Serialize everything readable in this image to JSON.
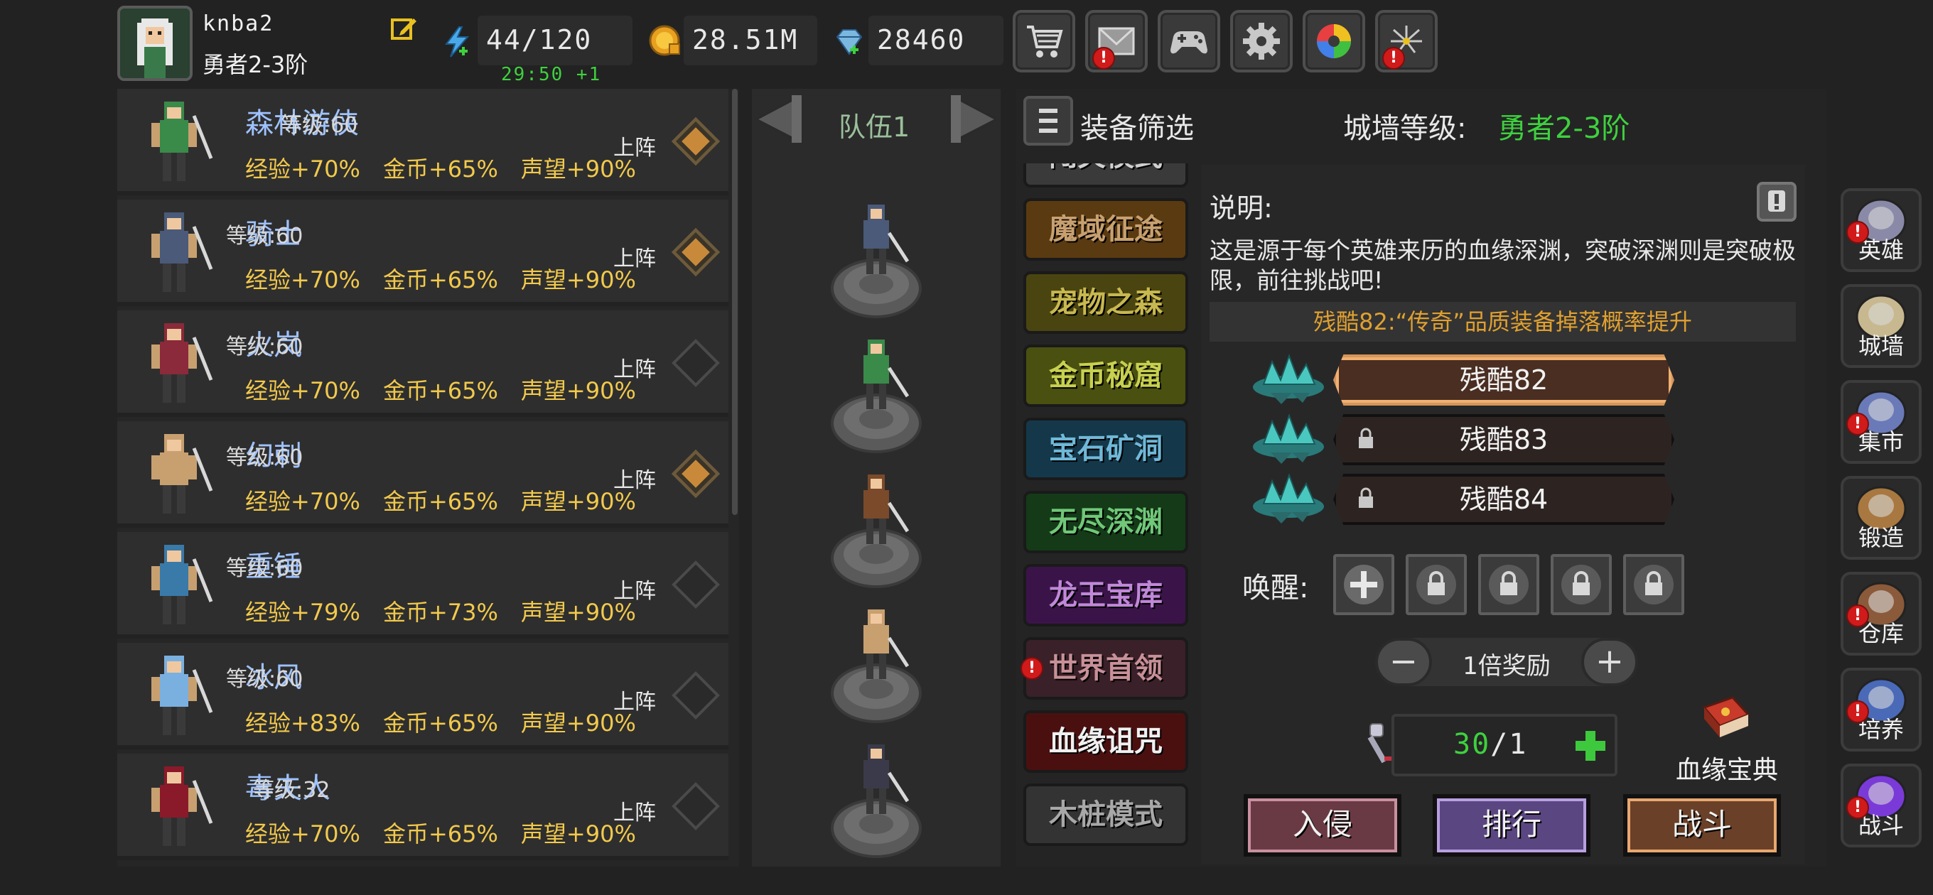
{
  "player": {
    "name": "knba2",
    "rank": "勇者2-3阶"
  },
  "resources": {
    "energy": "44/120",
    "energy_timer": "29:50 +1",
    "gold": "28.51M",
    "gems": "28460"
  },
  "top_buttons": [
    {
      "name": "shop",
      "icon": "cart-icon",
      "alert": false
    },
    {
      "name": "mail",
      "icon": "mail-icon",
      "alert": true
    },
    {
      "name": "gamepad",
      "icon": "gamepad-icon",
      "alert": false
    },
    {
      "name": "settings",
      "icon": "gear-icon",
      "alert": false
    },
    {
      "name": "gacha",
      "icon": "color-wheel-icon",
      "alert": false
    },
    {
      "name": "fireworks",
      "icon": "fireworks-icon",
      "alert": true
    }
  ],
  "heroes": [
    {
      "name": "森林游侠",
      "level": "等级:60",
      "exp": "经验+70%",
      "gold": "金币+65%",
      "fame": "声望+90%",
      "deploy": "上阵",
      "active": true,
      "color": "#3a8a4a"
    },
    {
      "name": "骑士",
      "level": "等级:60",
      "exp": "经验+70%",
      "gold": "金币+65%",
      "fame": "声望+90%",
      "deploy": "上阵",
      "active": true,
      "color": "#4a5a78"
    },
    {
      "name": "火岚",
      "level": "等级:60",
      "exp": "经验+70%",
      "gold": "金币+65%",
      "fame": "声望+90%",
      "deploy": "上阵",
      "active": false,
      "color": "#8a2a3a"
    },
    {
      "name": "幻刺",
      "level": "等级:60",
      "exp": "经验+70%",
      "gold": "金币+65%",
      "fame": "声望+90%",
      "deploy": "上阵",
      "active": true,
      "color": "#c8a070"
    },
    {
      "name": "重锤",
      "level": "等级:60",
      "exp": "经验+79%",
      "gold": "金币+73%",
      "fame": "声望+90%",
      "deploy": "上阵",
      "active": false,
      "color": "#3a7aa8"
    },
    {
      "name": "冰风",
      "level": "等级:60",
      "exp": "经验+83%",
      "gold": "金币+65%",
      "fame": "声望+90%",
      "deploy": "上阵",
      "active": false,
      "color": "#7ab0e0"
    },
    {
      "name": "毒夫人",
      "level": "等级:32",
      "exp": "经验+70%",
      "gold": "金币+65%",
      "fame": "声望+90%",
      "deploy": "上阵",
      "active": false,
      "color": "#8a1a2a"
    }
  ],
  "team": {
    "title": "队伍1",
    "members": [
      "#4a5a78",
      "#3a8a4a",
      "#7a4a2a",
      "#c8a070",
      "#3a3a4a"
    ]
  },
  "filter_label": "装备筛选",
  "wall": {
    "label": "城墙等级:",
    "value": "勇者2-3阶"
  },
  "modes": [
    {
      "label": "闯关模式",
      "bg": "#3a3a3a",
      "fg": "#d0d0d0"
    },
    {
      "label": "魔域征途",
      "bg": "#5a3a10",
      "fg": "#c8a070"
    },
    {
      "label": "宠物之森",
      "bg": "#4a4410",
      "fg": "#c8b850"
    },
    {
      "label": "金币秘窟",
      "bg": "#4a5010",
      "fg": "#c8d050"
    },
    {
      "label": "宝石矿洞",
      "bg": "#14384a",
      "fg": "#70b8d8"
    },
    {
      "label": "无尽深渊",
      "bg": "#143a18",
      "fg": "#70c878"
    },
    {
      "label": "龙王宝库",
      "bg": "#3a1448",
      "fg": "#c088d8"
    },
    {
      "label": "世界首领",
      "bg": "#3a2028",
      "fg": "#c89098",
      "alert": true
    },
    {
      "label": "血缘诅咒",
      "bg": "#4a1010",
      "fg": "#f0f0f0"
    },
    {
      "label": "木桩模式",
      "bg": "#333333",
      "fg": "#a8a8a8"
    }
  ],
  "info": {
    "title": "说明:",
    "text": "这是源于每个英雄来历的血缘深渊，突破深渊则是突破极限，前往挑战吧!",
    "bonus": "残酷82:“传奇”品质装备掉落概率提升"
  },
  "difficulties": [
    {
      "label": "残酷82",
      "locked": false,
      "selected": true
    },
    {
      "label": "残酷83",
      "locked": true,
      "selected": false
    },
    {
      "label": "残酷84",
      "locked": true,
      "selected": false
    }
  ],
  "awaken": {
    "label": "唤醒:",
    "slots": [
      "add",
      "locked",
      "locked",
      "locked",
      "locked"
    ]
  },
  "multiplier": {
    "label": "1倍奖励",
    "minus": "−",
    "plus": "+"
  },
  "counter": {
    "value": "30",
    "sep": "/",
    "max": "1"
  },
  "codex": {
    "label": "血缘宝典"
  },
  "actions": [
    {
      "label": "入侵",
      "bg": "#6a3a44",
      "border": "#c890a0"
    },
    {
      "label": "排行",
      "bg": "#5a4680",
      "border": "#b8a0e0"
    },
    {
      "label": "战斗",
      "bg": "#6a4028",
      "border": "#e8a870"
    }
  ],
  "side_menu": [
    {
      "label": "英雄",
      "icon": "helmet-icon",
      "alert": true
    },
    {
      "label": "城墙",
      "icon": "castle-icon",
      "alert": false
    },
    {
      "label": "集市",
      "icon": "market-icon",
      "alert": true
    },
    {
      "label": "锻造",
      "icon": "anvil-icon",
      "alert": false
    },
    {
      "label": "仓库",
      "icon": "chest-icon",
      "alert": true
    },
    {
      "label": "培养",
      "icon": "chalice-icon",
      "alert": true
    },
    {
      "label": "战斗",
      "icon": "portal-icon",
      "alert": true
    }
  ],
  "colors": {
    "green": "#3ed13e",
    "gold": "#f2c94c",
    "hero_name": "#9ec2ff",
    "bonus": "#e0a030"
  }
}
